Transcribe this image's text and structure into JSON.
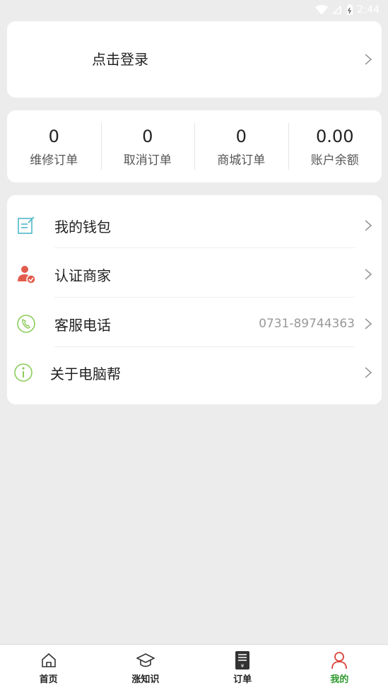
{
  "status_bar": {
    "time": "2:44"
  },
  "login": {
    "label": "点击登录"
  },
  "stats": [
    {
      "value": "0",
      "label": "维修订单"
    },
    {
      "value": "0",
      "label": "取消订单"
    },
    {
      "value": "0",
      "label": "商城订单"
    },
    {
      "value": "0.00",
      "label": "账户余额"
    }
  ],
  "menu": {
    "wallet": {
      "label": "我的钱包",
      "icon": "wallet-note-icon"
    },
    "merchant": {
      "label": "认证商家",
      "icon": "verified-user-icon"
    },
    "service": {
      "label": "客服电话",
      "value": "0731-89744363",
      "icon": "phone-icon"
    },
    "about": {
      "label": "关于电脑帮",
      "icon": "info-icon"
    }
  },
  "tabs": [
    {
      "label": "首页",
      "icon": "home-icon"
    },
    {
      "label": "涨知识",
      "icon": "graduation-cap-icon"
    },
    {
      "label": "订单",
      "icon": "order-receipt-icon"
    },
    {
      "label": "我的",
      "icon": "user-icon",
      "active": true
    }
  ],
  "colors": {
    "accent_green": "#2e9a2e",
    "icon_red": "#e35b4c",
    "icon_teal": "#4fb8c9",
    "icon_light_green": "#8ccc5a"
  }
}
